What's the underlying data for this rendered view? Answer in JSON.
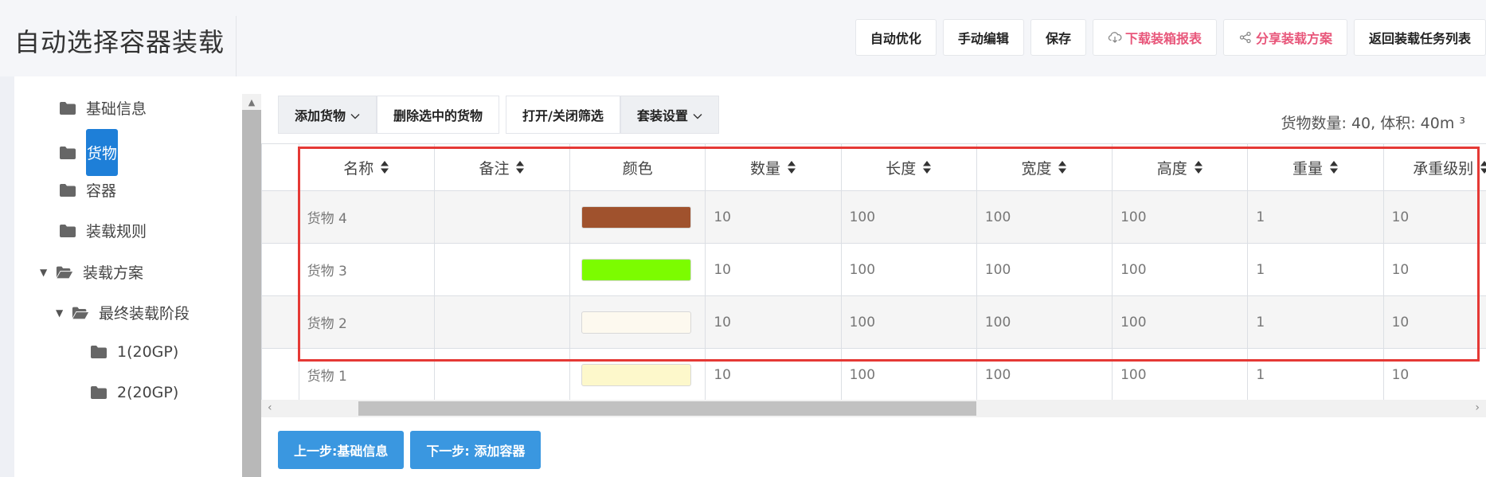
{
  "page_title": "自动选择容器装载",
  "toolbar": {
    "auto_optimize": "自动优化",
    "manual_edit": "手动编辑",
    "save": "保存",
    "download_report": "下载装箱报表",
    "share_plan": "分享装载方案",
    "back_to_tasks": "返回装载任务列表"
  },
  "sidebar": {
    "items": [
      {
        "label": "基础信息"
      },
      {
        "label": "货物"
      },
      {
        "label": "容器"
      },
      {
        "label": "装载规则"
      },
      {
        "label": "装载方案"
      },
      {
        "label": "最终装载阶段"
      },
      {
        "label": "1(20GP)"
      },
      {
        "label": "2(20GP)"
      }
    ]
  },
  "grid_toolbar": {
    "add_cargo": "添加货物",
    "delete_selected": "删除选中的货物",
    "toggle_filter": "打开/关闭筛选",
    "set_settings": "套装设置"
  },
  "stats": "货物数量: 40, 体积: 40m ³",
  "table": {
    "headers": [
      "名称",
      "备注",
      "颜色",
      "数量",
      "长度",
      "宽度",
      "高度",
      "重量",
      "承重级别"
    ],
    "rows": [
      {
        "name": "货物 4",
        "note": "",
        "color": "#a0522d",
        "qty": "10",
        "length": "100",
        "width": "100",
        "height": "100",
        "weight": "1",
        "load_level": "10"
      },
      {
        "name": "货物 3",
        "note": "",
        "color": "#7cfc00",
        "qty": "10",
        "length": "100",
        "width": "100",
        "height": "100",
        "weight": "1",
        "load_level": "10"
      },
      {
        "name": "货物 2",
        "note": "",
        "color": "#fdf9ef",
        "qty": "10",
        "length": "100",
        "width": "100",
        "height": "100",
        "weight": "1",
        "load_level": "10"
      },
      {
        "name": "货物 1",
        "note": "",
        "color": "#fdf8cb",
        "qty": "10",
        "length": "100",
        "width": "100",
        "height": "100",
        "weight": "1",
        "load_level": "10"
      }
    ]
  },
  "bottom": {
    "prev": "上一步:基础信息",
    "next": "下一步: 添加容器"
  },
  "colors": {
    "accent": "#1e7fd8",
    "button_blue": "#3a97e0",
    "pink": "#e8567a",
    "highlight_red": "#e53935"
  }
}
